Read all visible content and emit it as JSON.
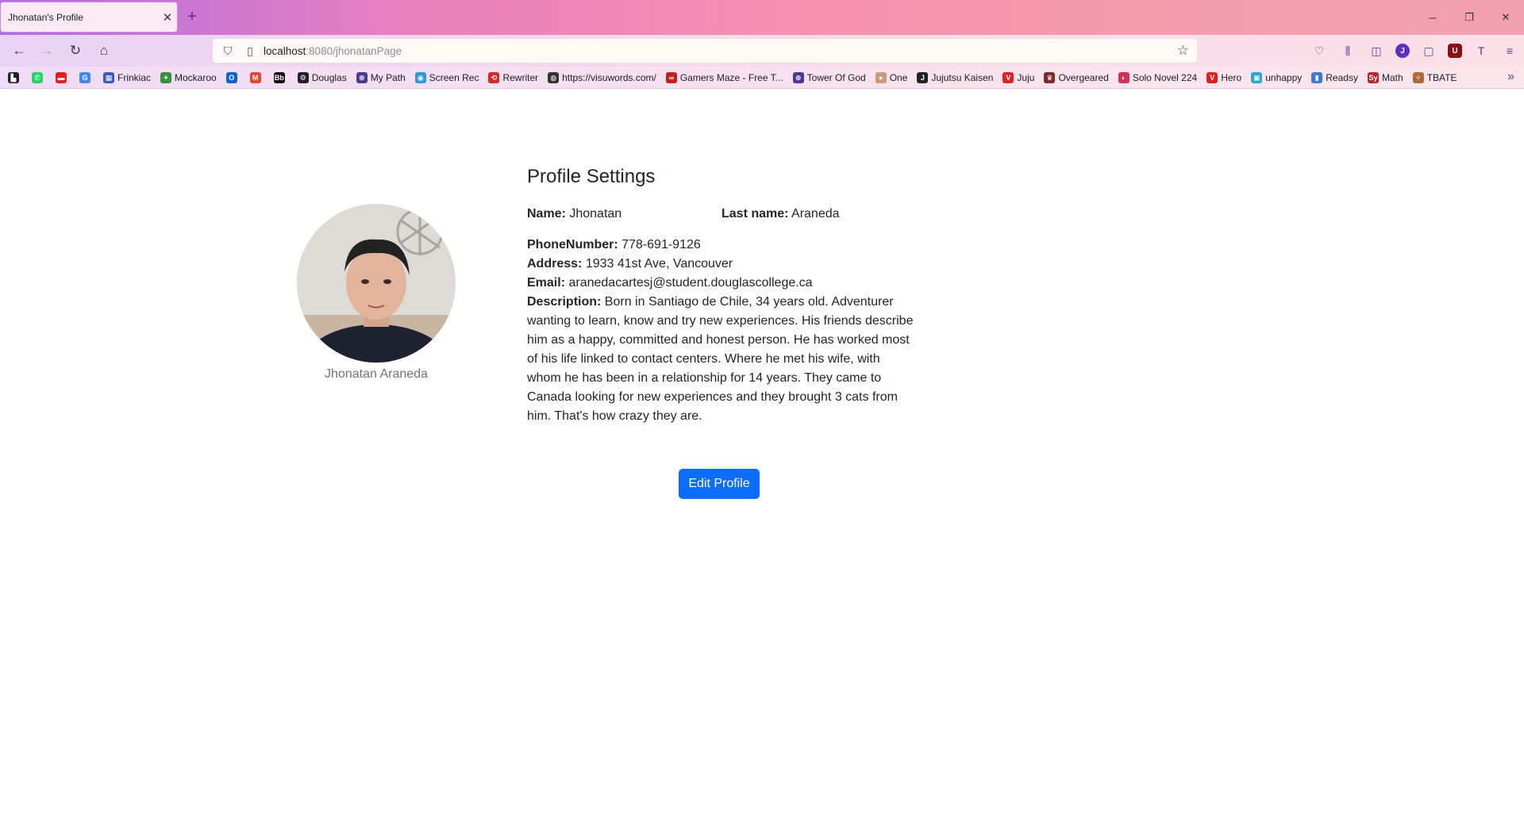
{
  "browser": {
    "tab_title": "Jhonatan's Profile",
    "tab_close": "✕",
    "new_tab": "+",
    "url_host": "localhost",
    "url_path": ":8080/jhonatanPage",
    "window_controls": {
      "minimize": "─",
      "restore": "❐",
      "close": "✕"
    },
    "bookmarks": [
      {
        "label": "",
        "icon_color": "#222222",
        "icon_text": "▙"
      },
      {
        "label": "",
        "icon_color": "#25d366",
        "icon_text": "✆"
      },
      {
        "label": "",
        "icon_color": "#e32020",
        "icon_text": "▬"
      },
      {
        "label": "",
        "icon_color": "#4285f4",
        "icon_text": "G"
      },
      {
        "label": "Frinkiac",
        "icon_color": "#3b5bbf",
        "icon_text": "▦"
      },
      {
        "label": "Mockaroo",
        "icon_color": "#3a8f3a",
        "icon_text": "✦"
      },
      {
        "label": "",
        "icon_color": "#0a64c8",
        "icon_text": "O"
      },
      {
        "label": "",
        "icon_color": "#ea4335",
        "icon_text": "M"
      },
      {
        "label": "",
        "icon_color": "#111111",
        "icon_text": "Bb"
      },
      {
        "label": "Douglas",
        "icon_color": "#222222",
        "icon_text": "⚙"
      },
      {
        "label": "My Path",
        "icon_color": "#4b3b8f",
        "icon_text": "⊕"
      },
      {
        "label": "Screen Rec",
        "icon_color": "#2b9bd8",
        "icon_text": "◉"
      },
      {
        "label": "Rewriter",
        "icon_color": "#d42a2a",
        "icon_text": "⟲"
      },
      {
        "label": "https://visuwords.com/",
        "icon_color": "#333333",
        "icon_text": "◍"
      },
      {
        "label": "Gamers Maze - Free T...",
        "icon_color": "#c02020",
        "icon_text": "∞"
      },
      {
        "label": "Tower Of God",
        "icon_color": "#4b3b8f",
        "icon_text": "⊕"
      },
      {
        "label": "One",
        "icon_color": "#c79a7a",
        "icon_text": "●"
      },
      {
        "label": "Jujutsu Kaisen",
        "icon_color": "#222222",
        "icon_text": "J"
      },
      {
        "label": "Juju",
        "icon_color": "#e02020",
        "icon_text": "V"
      },
      {
        "label": "Overgeared",
        "icon_color": "#7a2a2a",
        "icon_text": "♛"
      },
      {
        "label": "Solo Novel 224",
        "icon_color": "#d0305a",
        "icon_text": "◐"
      },
      {
        "label": "Hero",
        "icon_color": "#e02020",
        "icon_text": "V"
      },
      {
        "label": "unhappy",
        "icon_color": "#2aa8c8",
        "icon_text": "▣"
      },
      {
        "label": "Readsy",
        "icon_color": "#3a7bd5",
        "icon_text": "▮"
      },
      {
        "label": "Math",
        "icon_color": "#c0202a",
        "icon_text": "Sy"
      },
      {
        "label": "TBATE",
        "icon_color": "#b06a3a",
        "icon_text": "✧"
      }
    ]
  },
  "icons": {
    "back": "←",
    "forward": "→",
    "reload": "↻",
    "home": "⌂",
    "shield": "⛉",
    "page": "▯",
    "star": "☆",
    "pocket": "♡",
    "library": "⫼",
    "sidebar": "◫",
    "account": "J",
    "extension": "▢",
    "ublock": "U",
    "translate": "T",
    "menu": "≡",
    "overflow": "»"
  },
  "profile": {
    "display_name": "Jhonatan Araneda",
    "heading": "Profile Settings",
    "name_label": "Name:",
    "name_value": "Jhonatan",
    "last_name_label": "Last name:",
    "last_name_value": "Araneda",
    "phone_label": "PhoneNumber:",
    "phone_value": "778-691-9126",
    "address_label": "Address:",
    "address_value": "1933 41st Ave, Vancouver",
    "email_label": "Email:",
    "email_value": "aranedacartesj@student.douglascollege.ca",
    "description_label": "Description:",
    "description_value": "Born in Santiago de Chile, 34 years old. Adventurer wanting to learn, know and try new experiences. His friends describe him as a happy, committed and honest person. He has worked most of his life linked to contact centers. Where he met his wife, with whom he has been in a relationship for 14 years. They came to Canada looking for new experiences and they brought 3 cats from him. That's how crazy they are.",
    "edit_button": "Edit Profile"
  },
  "colors": {
    "primary_button": "#0d6efd",
    "muted_text": "#6c757d"
  }
}
